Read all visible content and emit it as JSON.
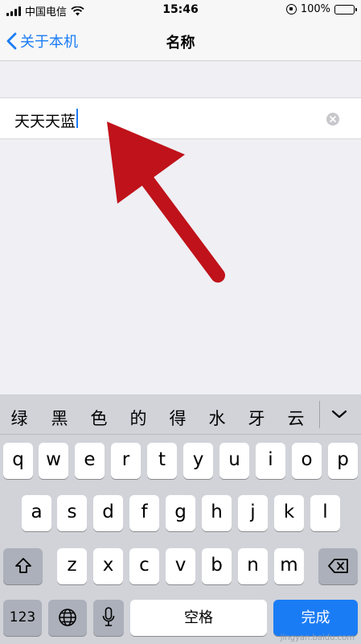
{
  "status_bar": {
    "carrier": "中国电信",
    "time": "15:46",
    "battery": "100%",
    "battery_level": 1.0
  },
  "nav": {
    "back_label": "关于本机",
    "title": "名称"
  },
  "field": {
    "value": "天天天蓝"
  },
  "keyboard": {
    "candidates": [
      "绿",
      "黑",
      "色",
      "的",
      "得",
      "水",
      "牙",
      "云"
    ],
    "row1": [
      "q",
      "w",
      "e",
      "r",
      "t",
      "y",
      "u",
      "i",
      "o",
      "p"
    ],
    "row2": [
      "a",
      "s",
      "d",
      "f",
      "g",
      "h",
      "j",
      "k",
      "l"
    ],
    "row3": [
      "z",
      "x",
      "c",
      "v",
      "b",
      "n",
      "m"
    ],
    "numbers_label": "123",
    "space_label": "空格",
    "done_label": "完成"
  },
  "watermark": "jingyan.baidu.com",
  "colors": {
    "accent": "#1a7cf5",
    "arrow": "#c0121a"
  }
}
